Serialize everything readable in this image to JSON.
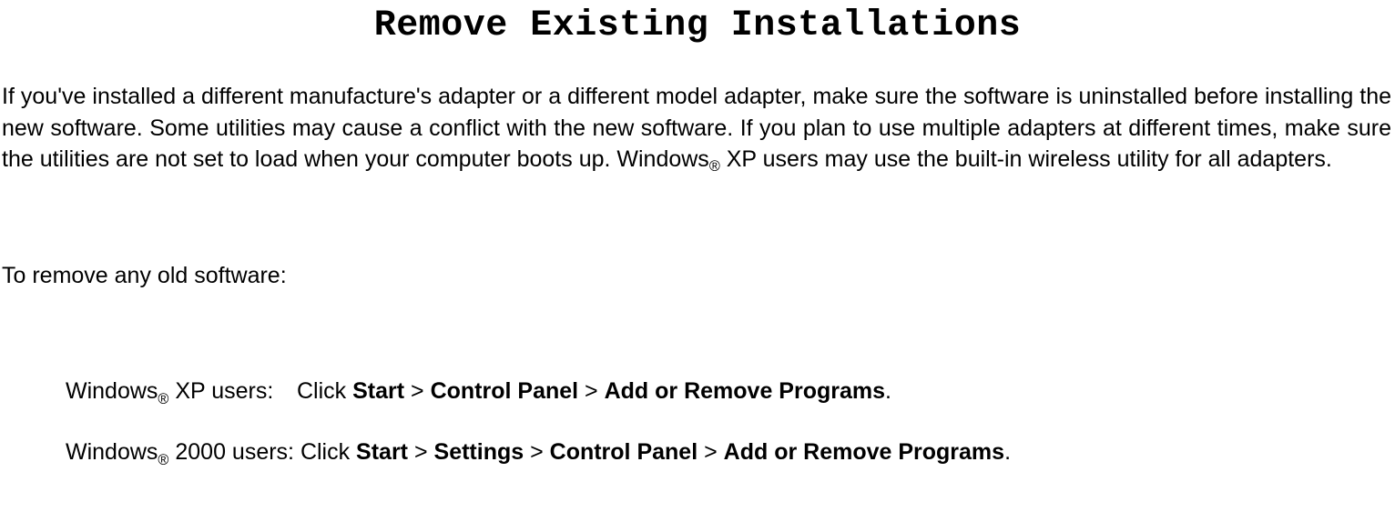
{
  "title": "Remove Existing Installations",
  "intro": {
    "t1": "If you've installed a different manufacture's adapter or a different model adapter, make sure the software is uninstalled before installing the new software. Some utilities may cause a conflict with the new software. If you plan to use multiple adapters at different times, make sure the utilities are not set to load when your computer boots up. Windows",
    "reg": "®",
    "t2": " XP users may use the built-in wireless utility for all adapters."
  },
  "lead": "To remove any old software:",
  "xp": {
    "os1": "Windows",
    "reg": "®",
    "os2": " XP users:",
    "click": "Click ",
    "start": "Start",
    "gt1": " > ",
    "cp": "Control Panel",
    "gt2": " > ",
    "arp": "Add or Remove Programs",
    "dot": "."
  },
  "w2k": {
    "os1": "Windows",
    "reg": "®",
    "os2": " 2000 users: Click ",
    "start": "Start",
    "gt1": " > ",
    "settings": "Settings",
    "gt2": " > ",
    "cp": "Control Panel",
    "gt3": " > ",
    "arp": "Add or Remove Programs",
    "dot": "."
  }
}
